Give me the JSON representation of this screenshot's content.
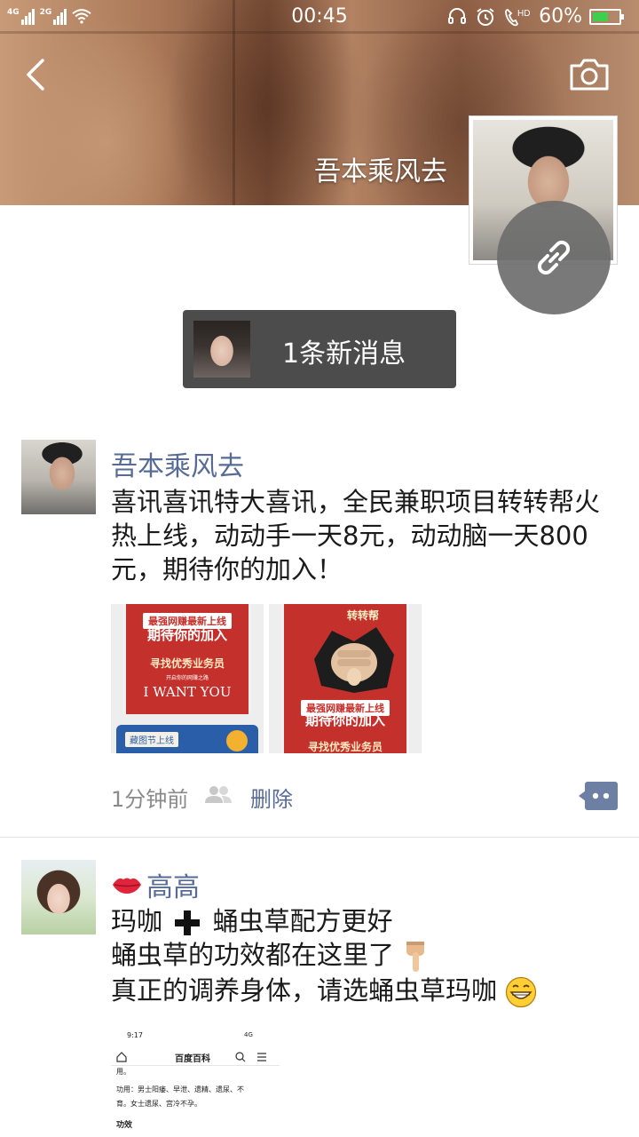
{
  "status_bar": {
    "net1": "4G",
    "net2": "2G",
    "time": "00:45",
    "battery_text": "60%",
    "battery_level": 0.6,
    "hd_label": "HD"
  },
  "header": {
    "profile_name": "吾本乘风去"
  },
  "new_messages": {
    "label": "1条新消息"
  },
  "posts": [
    {
      "author": "吾本乘风去",
      "text": "喜讯喜讯特大喜讯，全民兼职项目转转帮火热上线，动动手一天8元，动动脑一天800元，期待你的加入！",
      "images": [
        {
          "lines": [
            "最强网赚最新上线",
            "期待你的加入",
            "寻找优秀业务员",
            "开启你的网赚之路",
            "I WANT YOU",
            "藏图节上线"
          ]
        },
        {
          "lines": [
            "转转帮",
            "最强网赚最新上线",
            "期待你的加入",
            "寻找优秀业务员"
          ]
        }
      ],
      "time": "1分钟前",
      "delete_label": "删除"
    },
    {
      "author": "高高",
      "lines": [
        "玛咖",
        "蛹虫草配方更好",
        "蛹虫草的功效都在这里了",
        "真正的调养身体，请选蛹虫草玛咖"
      ],
      "screenshot": {
        "time": "9:17",
        "signal": "4G",
        "title": "百度百科",
        "row1": "用。",
        "row2": "功用：男士阳痿、早泄、遗精、遗尿、不",
        "row3": "育。女士遗尿、宫冷不孕。",
        "row4": "功效"
      }
    }
  ],
  "colors": {
    "link_blue": "#576b95",
    "pill_bg": "#4c4c4c",
    "poster_red": "#c4312c"
  },
  "icons": [
    "back-arrow-icon",
    "camera-icon",
    "link-icon",
    "friends-icon",
    "comment-more-icon",
    "lips-icon",
    "plus-icon",
    "pointing-down-icon",
    "grin-icon"
  ]
}
